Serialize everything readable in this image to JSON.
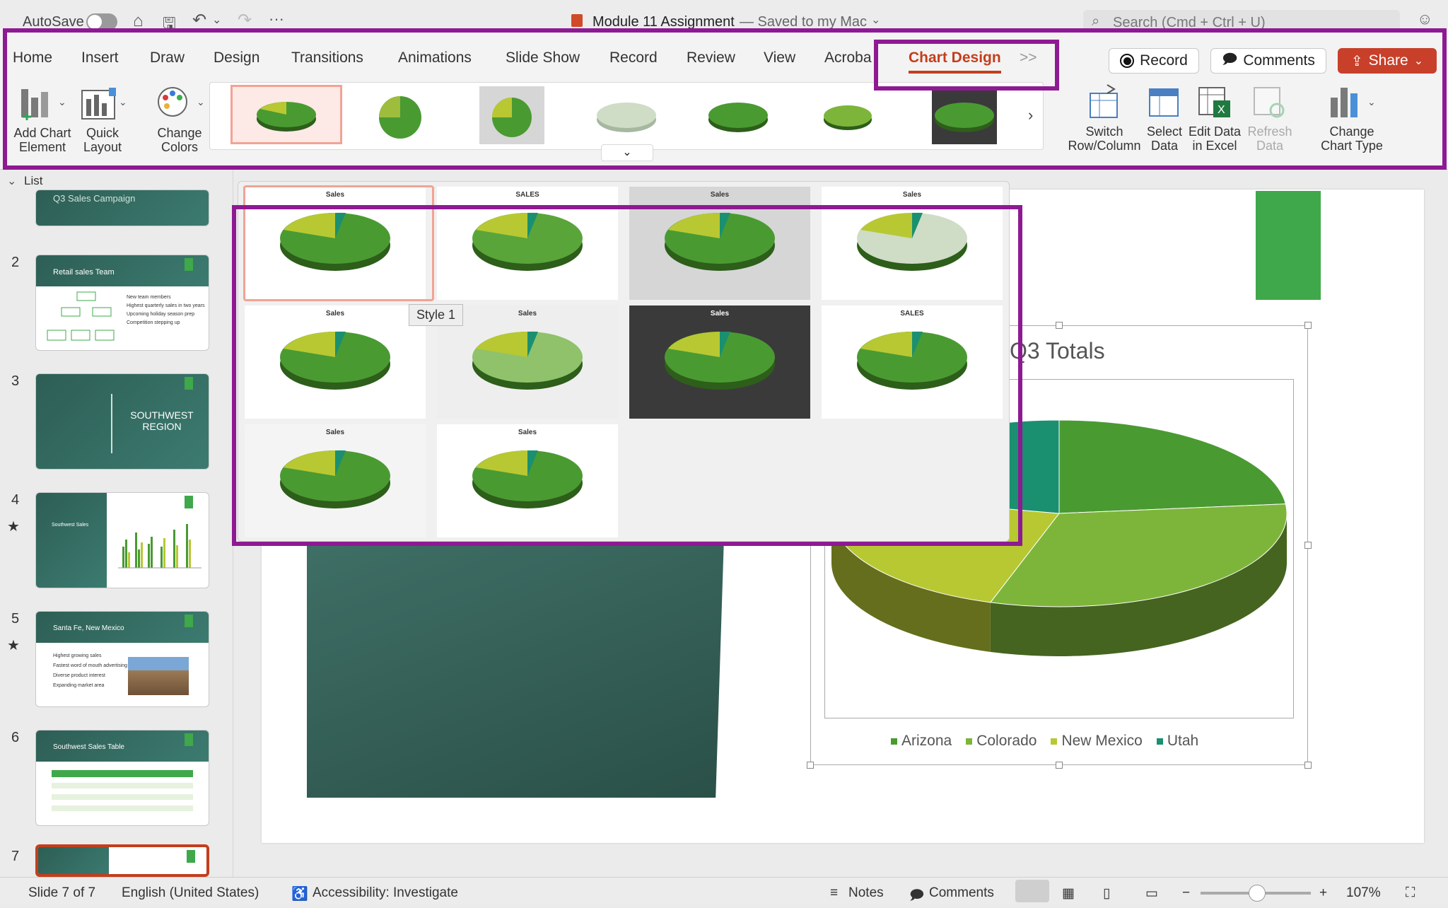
{
  "titlebar": {
    "autosave": "AutoSave",
    "doc_title": "Module 11 Assignment",
    "saved_status": "— Saved to my Mac",
    "search_placeholder": "Search (Cmd + Ctrl + U)"
  },
  "ribbon": {
    "tabs": [
      "Home",
      "Insert",
      "Draw",
      "Design",
      "Transitions",
      "Animations",
      "Slide Show",
      "Record",
      "Review",
      "View",
      "Acroba",
      "Chart Design"
    ],
    "active_tab": "Chart Design",
    "overflow_tabs": ">>",
    "record_button": "Record",
    "comments_button": "Comments",
    "share_button": "Share",
    "add_chart_element": [
      "Add Chart",
      "Element"
    ],
    "quick_layout": [
      "Quick",
      "Layout"
    ],
    "change_colors": [
      "Change",
      "Colors"
    ],
    "switch_row_column": [
      "Switch",
      "Row/Column"
    ],
    "select_data": [
      "Select",
      "Data"
    ],
    "edit_data_excel": [
      "Edit Data",
      "in Excel"
    ],
    "refresh_data": [
      "Refresh",
      "Data"
    ],
    "change_chart_type": [
      "Change",
      "Chart Type"
    ],
    "gallery_arrow": "›",
    "gallery_expand": "⌄"
  },
  "left_pane": {
    "header": "List",
    "slides": [
      {
        "num": "",
        "title": "Q3 Sales Campaign"
      },
      {
        "num": "2",
        "title": "Retail sales Team"
      },
      {
        "num": "3",
        "title": "SOUTHWEST REGION"
      },
      {
        "num": "4",
        "title": "Southwest Sales"
      },
      {
        "num": "5",
        "title": "Santa Fe, New Mexico"
      },
      {
        "num": "6",
        "title": "Southwest Sales Table"
      },
      {
        "num": "7",
        "title": ""
      }
    ],
    "team_bullets": [
      "New team members",
      "Highest quarterly sales in two years",
      "Upcoming holiday season prep",
      "Competition stepping up"
    ],
    "santa_fe_bullets": [
      "Highest growing sales",
      "Fastest word of mouth advertising",
      "Diverse product interest",
      "Expanding market area"
    ]
  },
  "style_gallery": {
    "tooltip": "Style 1",
    "styles": [
      {
        "title": "Sales"
      },
      {
        "title": "SALES"
      },
      {
        "title": "Sales"
      },
      {
        "title": "Sales"
      },
      {
        "title": "Sales"
      },
      {
        "title": "Sales"
      },
      {
        "title": "Sales"
      },
      {
        "title": "SALES"
      },
      {
        "title": "Sales"
      },
      {
        "title": "Sales"
      }
    ]
  },
  "slide": {
    "chart_title": "Q3 Totals"
  },
  "chart_data": {
    "type": "pie",
    "title": "Q3 Totals",
    "categories": [
      "Arizona",
      "Colorado",
      "New Mexico",
      "Utah"
    ],
    "values": [
      75377,
      101482,
      75362,
      70061
    ],
    "colors": [
      "#4a9a32",
      "#7db53a",
      "#b8c833",
      "#1a9070"
    ],
    "legend": "bottom"
  },
  "status": {
    "slide_pos": "Slide 7 of 7",
    "language": "English (United States)",
    "accessibility": "Accessibility: Investigate",
    "notes": "Notes",
    "comments": "Comments",
    "zoom": "107%"
  }
}
